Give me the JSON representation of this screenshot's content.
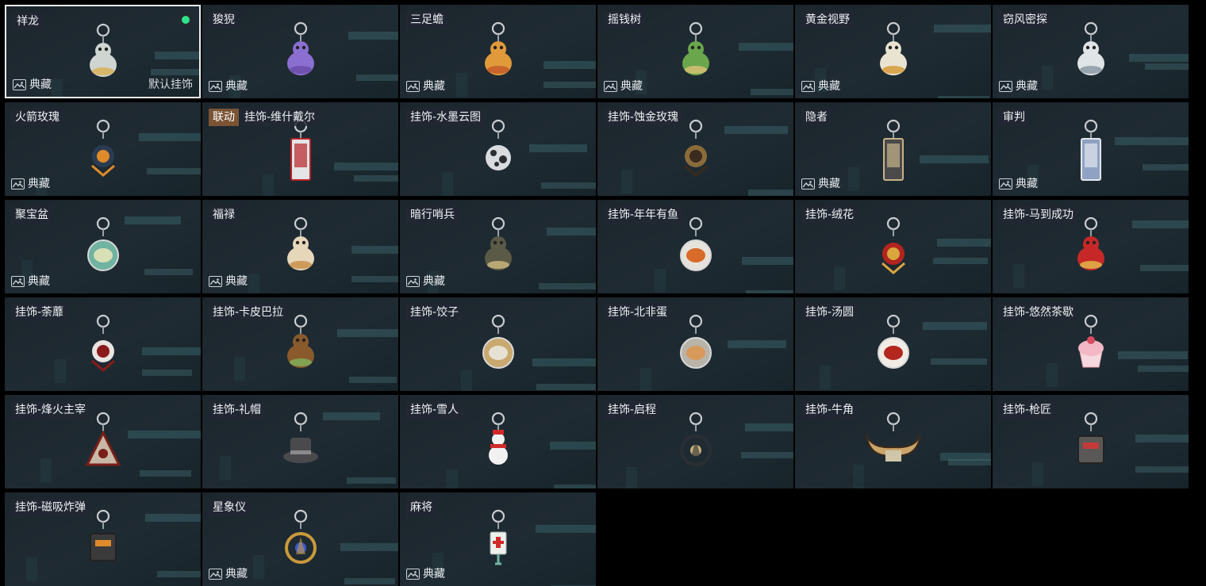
{
  "labels": {
    "collection": "典藏",
    "default_charm": "默认挂饰"
  },
  "items": [
    {
      "name": "祥龙",
      "collection": true,
      "selected": true,
      "is_default": true,
      "equipped": true,
      "icon": "dragon-charm-icon",
      "color": "#cfd6d2",
      "accent": "#d8b15a"
    },
    {
      "name": "狻猊",
      "collection": true,
      "icon": "lion-charm-icon",
      "color": "#8a6fd0",
      "accent": "#6a4ea8"
    },
    {
      "name": "三足蟾",
      "collection": true,
      "icon": "toad-charm-icon",
      "color": "#e19a3a",
      "accent": "#c45a2a"
    },
    {
      "name": "摇钱树",
      "collection": true,
      "icon": "money-tree-charm-icon",
      "color": "#6aa64c",
      "accent": "#d7c073"
    },
    {
      "name": "黄金视野",
      "collection": true,
      "icon": "golden-cat-charm-icon",
      "color": "#e9e4d2",
      "accent": "#d79a3a"
    },
    {
      "name": "窃风密探",
      "collection": true,
      "icon": "spy-charm-icon",
      "color": "#dfe4e6",
      "accent": "#8c9aa4"
    },
    {
      "name": "火箭玫瑰",
      "collection": true,
      "icon": "rocket-rose-charm-icon",
      "color": "#2b3c52",
      "accent": "#e08a2a"
    },
    {
      "name": "挂饰-维什戴尔",
      "collab": "联动",
      "icon": "card-charm-icon",
      "color": "#e3e4e6",
      "accent": "#b8242a"
    },
    {
      "name": "挂饰-水墨云图",
      "icon": "ink-ball-charm-icon",
      "color": "#d9dcdf",
      "accent": "#2a2d31"
    },
    {
      "name": "挂饰-蚀金玫瑰",
      "icon": "gold-rose-charm-icon",
      "color": "#8a6c3a",
      "accent": "#3b2a1e"
    },
    {
      "name": "隐者",
      "collection": true,
      "icon": "hermit-card-charm-icon",
      "color": "#4a4a4a",
      "accent": "#c8b38a"
    },
    {
      "name": "审判",
      "collection": true,
      "icon": "judgment-card-charm-icon",
      "color": "#8fa2c4",
      "accent": "#e3e6ee"
    },
    {
      "name": "聚宝盆",
      "collection": true,
      "icon": "treasure-bowl-charm-icon",
      "color": "#d7e0b6",
      "accent": "#6fb3a0"
    },
    {
      "name": "福禄",
      "collection": true,
      "icon": "gourd-charm-icon",
      "color": "#e6d7bb",
      "accent": "#c9904a"
    },
    {
      "name": "暗行哨兵",
      "collection": true,
      "icon": "sentinel-charm-icon",
      "color": "#5b5a46",
      "accent": "#c8b67e"
    },
    {
      "name": "挂饰-年年有鱼",
      "icon": "fish-plate-charm-icon",
      "color": "#d86a2a",
      "accent": "#e6e2dc"
    },
    {
      "name": "挂饰-绒花",
      "icon": "velvet-flower-charm-icon",
      "color": "#b3241f",
      "accent": "#d9a640"
    },
    {
      "name": "挂饰-马到成功",
      "icon": "horse-charm-icon",
      "color": "#c62828",
      "accent": "#e0b54a"
    },
    {
      "name": "挂饰-荼蘼",
      "icon": "roses-charm-icon",
      "color": "#e8e4e2",
      "accent": "#8a1a1a"
    },
    {
      "name": "挂饰-卡皮巴拉",
      "icon": "capybara-charm-icon",
      "color": "#8a5a2c",
      "accent": "#7fae5a"
    },
    {
      "name": "挂饰-饺子",
      "icon": "dumpling-plate-charm-icon",
      "color": "#e7e1d4",
      "accent": "#c9a96f"
    },
    {
      "name": "挂饰-北非蛋",
      "icon": "shakshuka-charm-icon",
      "color": "#d89a5a",
      "accent": "#b9b4aa"
    },
    {
      "name": "挂饰-汤圆",
      "icon": "tangyuan-bowl-charm-icon",
      "color": "#b3271f",
      "accent": "#f1ede6"
    },
    {
      "name": "挂饰-悠然茶歇",
      "icon": "cupcake-charm-icon",
      "color": "#f2b8c6",
      "accent": "#d94b62"
    },
    {
      "name": "挂饰-烽火主宰",
      "icon": "triangle-emblem-charm-icon",
      "color": "#c8b9a6",
      "accent": "#7a1e18"
    },
    {
      "name": "挂饰-礼帽",
      "icon": "top-hat-charm-icon",
      "color": "#4a4a4c",
      "accent": "#8a8a8c"
    },
    {
      "name": "挂饰-雪人",
      "icon": "snowman-charm-icon",
      "color": "#f1f1f1",
      "accent": "#d12a2a"
    },
    {
      "name": "挂饰-启程",
      "icon": "compass-medal-charm-icon",
      "color": "#2a2f33",
      "accent": "#c8b07a"
    },
    {
      "name": "挂饰-牛角",
      "icon": "bull-horns-charm-icon",
      "color": "#caa46a",
      "accent": "#3a2a1a"
    },
    {
      "name": "挂饰-枪匠",
      "icon": "gunsmith-case-charm-icon",
      "color": "#5a5856",
      "accent": "#c43a3a"
    },
    {
      "name": "挂饰-磁吸炸弹",
      "icon": "magnetic-bomb-charm-icon",
      "color": "#3a3a3a",
      "accent": "#e08a2a"
    },
    {
      "name": "星象仪",
      "collection": true,
      "icon": "armillary-charm-icon",
      "color": "#c99a3a",
      "accent": "#3a5ad1"
    },
    {
      "name": "麻将",
      "collection": true,
      "icon": "mahjong-tile-charm-icon",
      "color": "#eef0ec",
      "accent": "#d12a2a"
    }
  ]
}
